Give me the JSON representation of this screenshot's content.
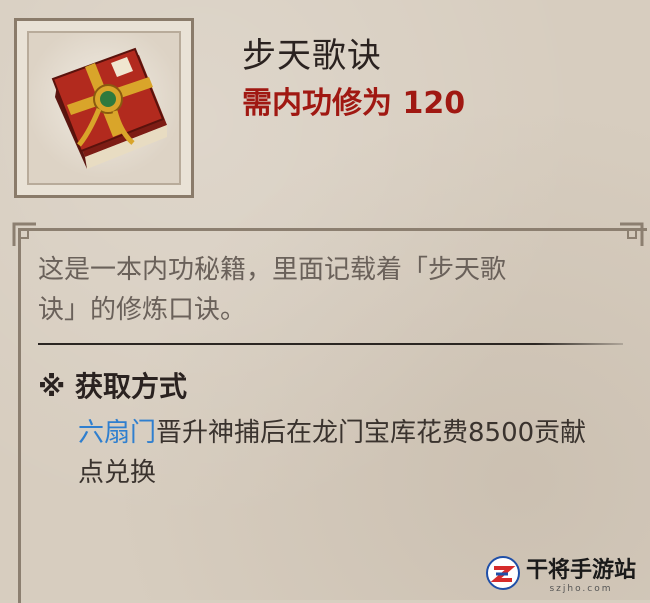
{
  "item": {
    "name": "步天歌诀",
    "requirement": "需内功修为 120",
    "icon": "book-icon"
  },
  "description": {
    "line1": "这是一本内功秘籍，里面记载着「步天歌",
    "line2": "诀」的修炼口诀。"
  },
  "acquisition": {
    "header": "※ 获取方式",
    "faction": "六扇门",
    "line1_rest": "晋升神捕后在龙门宝库花费8500贡献",
    "line2": "点兑换"
  },
  "watermark": {
    "name": "干将手游站",
    "url": "szjho.com"
  },
  "colors": {
    "requirement": "#a01812",
    "faction_link": "#2f7fcf",
    "panel": "#d7cdbf"
  }
}
